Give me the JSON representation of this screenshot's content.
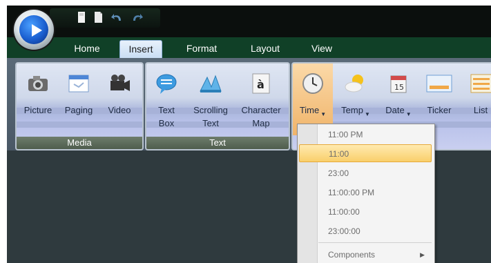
{
  "quick_access": {
    "icons": [
      "save-icon",
      "new-document-icon",
      "undo-icon",
      "redo-icon"
    ]
  },
  "tabs": [
    {
      "label": "Home",
      "active": false
    },
    {
      "label": "Insert",
      "active": true
    },
    {
      "label": "Format",
      "active": false
    },
    {
      "label": "Layout",
      "active": false
    },
    {
      "label": "View",
      "active": false
    }
  ],
  "groups": {
    "media": {
      "label": "Media",
      "buttons": [
        {
          "label": "Picture",
          "icon": "camera-icon"
        },
        {
          "label": "Paging",
          "icon": "paging-icon"
        },
        {
          "label": "Video",
          "icon": "video-camera-icon"
        }
      ]
    },
    "text": {
      "label": "Text",
      "buttons": [
        {
          "line1": "Text",
          "line2": "Box",
          "icon": "text-box-icon"
        },
        {
          "line1": "Scrolling",
          "line2": "Text",
          "icon": "scrolling-text-icon"
        },
        {
          "line1": "Character",
          "line2": "Map",
          "icon": "character-map-icon"
        }
      ]
    },
    "components": {
      "buttons": [
        {
          "label": "Time",
          "icon": "clock-icon",
          "dropdown": true
        },
        {
          "label": "Temp",
          "icon": "weather-icon",
          "dropdown": true
        },
        {
          "label": "Date",
          "icon": "calendar-icon",
          "dropdown": true
        },
        {
          "label": "Ticker",
          "icon": "ticker-icon",
          "dropdown": false
        },
        {
          "label": "List",
          "icon": "list-icon",
          "dropdown": false
        }
      ]
    }
  },
  "time_menu": {
    "items": [
      "11:00 PM",
      "11:00",
      "23:00",
      "11:00:00 PM",
      "11:00:00",
      "23:00:00"
    ],
    "selected": "11:00",
    "components_label": "Components"
  },
  "colors": {
    "accent_tab": "#c8ddf3",
    "title_strip": "#104027",
    "selection": "#f9cf6b",
    "workspace": "#2f3a3e"
  }
}
